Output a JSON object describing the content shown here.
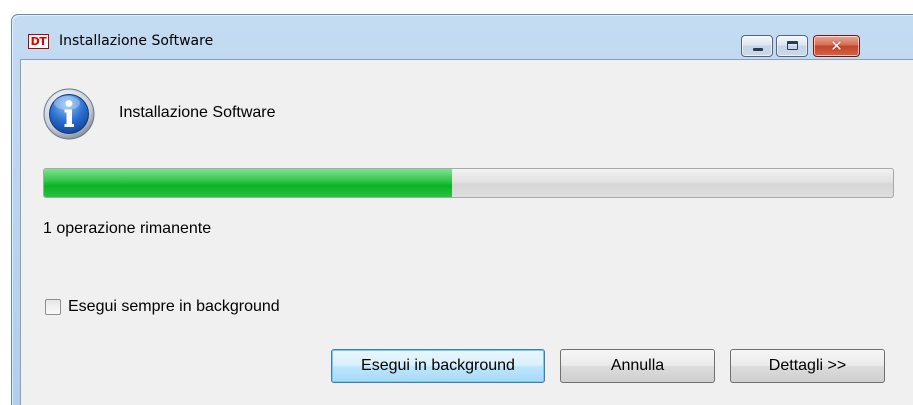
{
  "window": {
    "logo_text": "DT",
    "title": "Installazione Software",
    "controls": {
      "minimize_icon": "minimize-icon",
      "maximize_icon": "maximize-icon",
      "close_icon": "close-icon",
      "close_glyph": "✕"
    }
  },
  "dialog": {
    "icon": "info-icon",
    "heading": "Installazione Software",
    "progress": {
      "value_percent": 48
    },
    "status": "1 operazione rimanente",
    "checkbox": {
      "label": "Esegui sempre in background",
      "checked": false
    },
    "buttons": {
      "run_background": "Esegui in background",
      "cancel": "Annulla",
      "details": "Dettagli >>"
    }
  },
  "colors": {
    "title_bar": "#c4dcf2",
    "client_bg": "#f0f0f0",
    "progress_green": "#0ab427",
    "close_red": "#c4432a"
  }
}
